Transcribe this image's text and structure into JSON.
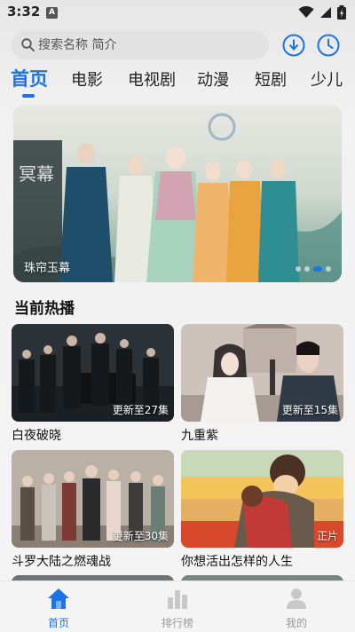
{
  "status_bar": {
    "time": "3:32",
    "notification_badge": "A"
  },
  "search": {
    "placeholder": "搜索名称 简介"
  },
  "tabs": [
    {
      "label": "首页",
      "active": true
    },
    {
      "label": "电影"
    },
    {
      "label": "电视剧"
    },
    {
      "label": "动漫"
    },
    {
      "label": "短剧"
    },
    {
      "label": "少儿"
    }
  ],
  "banner": {
    "title": "珠帘玉幕",
    "dots": 4,
    "active_dot": 3
  },
  "section": {
    "title": "当前热播"
  },
  "cards": [
    {
      "title": "白夜破晓",
      "badge": "更新至27集"
    },
    {
      "title": "九重紫",
      "badge": "更新至15集"
    },
    {
      "title": "斗罗大陆之燃魂战",
      "badge": "更新至30集"
    },
    {
      "title": "你想活出怎样的人生",
      "badge": "正片"
    }
  ],
  "bottom_nav": [
    {
      "label": "首页",
      "icon": "home-icon",
      "active": true
    },
    {
      "label": "排行榜",
      "icon": "ranking-icon"
    },
    {
      "label": "我的",
      "icon": "profile-icon"
    }
  ],
  "colors": {
    "accent": "#1a73e8",
    "inactive": "#9a9a9a"
  }
}
